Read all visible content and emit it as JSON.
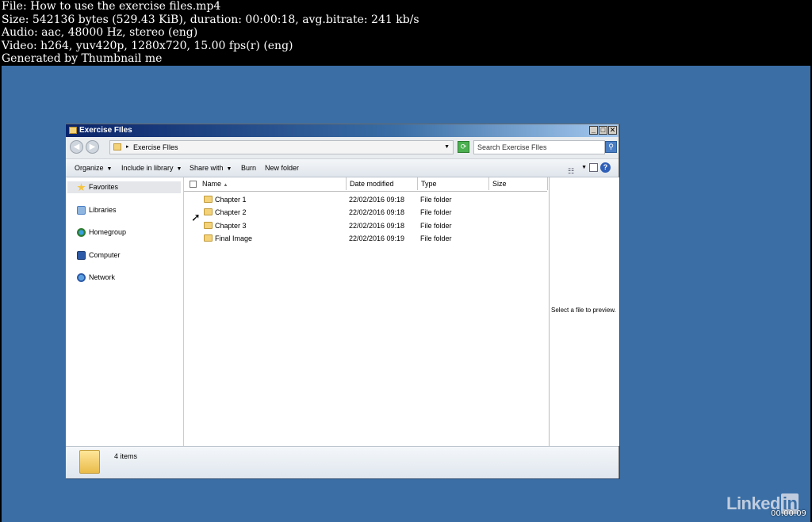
{
  "video_info": {
    "line1": "File: How to use the exercise files.mp4",
    "line2": "Size: 542136 bytes (529.43 KiB), duration: 00:00:18, avg.bitrate: 241 kb/s",
    "line3": "Audio: aac, 48000 Hz, stereo (eng)",
    "line4": "Video: h264, yuv420p, 1280x720, 15.00 fps(r) (eng)",
    "line5": "Generated by Thumbnail me"
  },
  "window": {
    "title": "Exercise FIles",
    "controls": {
      "minimize": "_",
      "maximize": "□",
      "close": "✕"
    }
  },
  "address": {
    "path": "Exercise FIles",
    "search_placeholder": "Search Exercise FIles"
  },
  "toolbar": {
    "organize": "Organize",
    "include_in_library": "Include in library",
    "share_with": "Share with",
    "burn": "Burn",
    "new_folder": "New folder"
  },
  "nav": {
    "items": [
      {
        "label": "Favorites",
        "icon": "star-icon"
      },
      {
        "label": "Libraries",
        "icon": "libraries-icon"
      },
      {
        "label": "Homegroup",
        "icon": "homegroup-icon"
      },
      {
        "label": "Computer",
        "icon": "computer-icon"
      },
      {
        "label": "Network",
        "icon": "network-icon"
      }
    ]
  },
  "columns": {
    "name": "Name",
    "date": "Date modified",
    "type": "Type",
    "size": "Size"
  },
  "files": [
    {
      "name": "Chapter 1",
      "date": "22/02/2016 09:18",
      "type": "File folder",
      "size": ""
    },
    {
      "name": "Chapter 2",
      "date": "22/02/2016 09:18",
      "type": "File folder",
      "size": ""
    },
    {
      "name": "Chapter 3",
      "date": "22/02/2016 09:18",
      "type": "File folder",
      "size": ""
    },
    {
      "name": "Final Image",
      "date": "22/02/2016 09:19",
      "type": "File folder",
      "size": ""
    }
  ],
  "preview": {
    "text": "Select a file to preview."
  },
  "details": {
    "count": "4 items"
  },
  "overlay": {
    "brand": "Linked",
    "brand_suffix": "in",
    "timecode": "00:00:09"
  },
  "colors": {
    "desktop": "#3a6ea5",
    "titlebar": "#0a246a"
  }
}
